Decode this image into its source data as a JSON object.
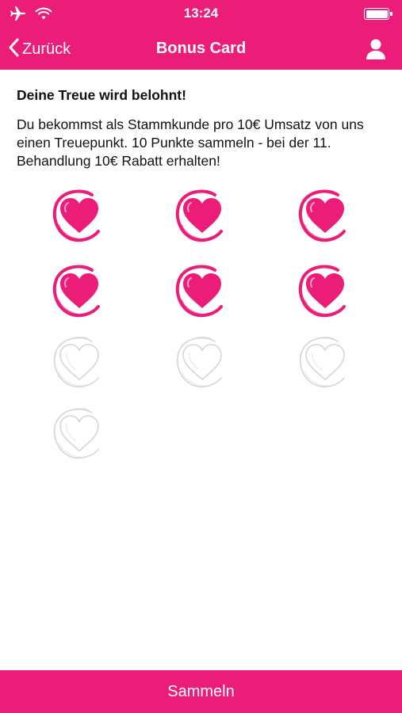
{
  "status_bar": {
    "time": "13:24"
  },
  "nav": {
    "back_label": "Zurück",
    "title": "Bonus Card"
  },
  "content": {
    "headline": "Deine Treue wird belohnt!",
    "description": "Du bekommst als Stammkunde pro 10€ Umsatz von uns einen Treuepunkt. 10 Punkte sammeln - bei der 11. Behandlung 10€ Rabatt erhalten!"
  },
  "stamps": {
    "total": 10,
    "collected": 6,
    "collected_color": "#ec1c79",
    "empty_color": "#d6d6d6"
  },
  "footer": {
    "button_label": "Sammeln"
  },
  "colors": {
    "brand": "#ec1c79",
    "text": "#111111",
    "background": "#ffffff"
  }
}
